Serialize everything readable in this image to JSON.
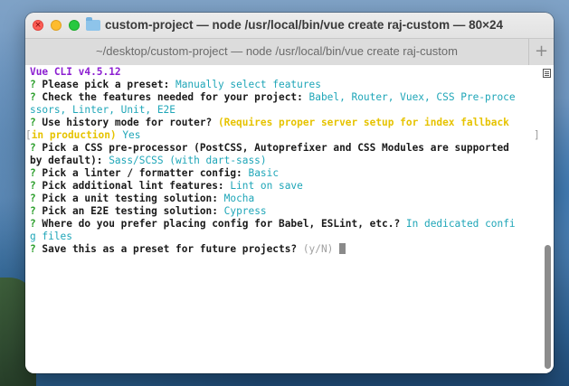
{
  "window": {
    "title": "custom-project — node /usr/local/bin/vue create raj-custom — 80×24",
    "close_glyph": "×"
  },
  "tab": {
    "title": "~/desktop/custom-project — node /usr/local/bin/vue create raj-custom",
    "new_tab_label": "+"
  },
  "icons": {
    "folder": "folder-icon",
    "scroll_menu": "menu-lines-icon"
  },
  "colors": {
    "prompt_q": "#2a9e2a",
    "answer": "#1fa6b8",
    "vue_cli": "#8c1fd1",
    "warning": "#e6c300"
  },
  "terminal": {
    "header": "Vue CLI v4.5.12",
    "lines": [
      {
        "q": "?",
        "text": " Please pick a preset: ",
        "answer": "Manually select features"
      },
      {
        "q": "?",
        "text": " Check the features needed for your project: ",
        "answer": "Babel, Router, Vuex, CSS Pre-proce"
      },
      {
        "answer": "ssors, Linter, Unit, E2E"
      },
      {
        "q": "?",
        "text": " Use history mode for router? ",
        "warn": "(Requires proper server setup for index fallback"
      },
      {
        "bracket_l": "[",
        "warn": "in production)",
        "answer": " Yes",
        "bracket_r": "]"
      },
      {
        "q": "?",
        "text": " Pick a CSS pre-processor (PostCSS, Autoprefixer and CSS Modules are supported"
      },
      {
        "text": "by default): ",
        "answer": "Sass/SCSS (with dart-sass)"
      },
      {
        "q": "?",
        "text": " Pick a linter / formatter config: ",
        "answer": "Basic"
      },
      {
        "q": "?",
        "text": " Pick additional lint features: ",
        "answer": "Lint on save"
      },
      {
        "q": "?",
        "text": " Pick a unit testing solution: ",
        "answer": "Mocha"
      },
      {
        "q": "?",
        "text": " Pick an E2E testing solution: ",
        "answer": "Cypress"
      },
      {
        "q": "?",
        "text": " Where do you prefer placing config for Babel, ESLint, etc.? ",
        "answer": "In dedicated confi"
      },
      {
        "answer": "g files"
      },
      {
        "q": "?",
        "text": " Save this as a preset for future projects? ",
        "dim": "(y/N)"
      }
    ]
  }
}
